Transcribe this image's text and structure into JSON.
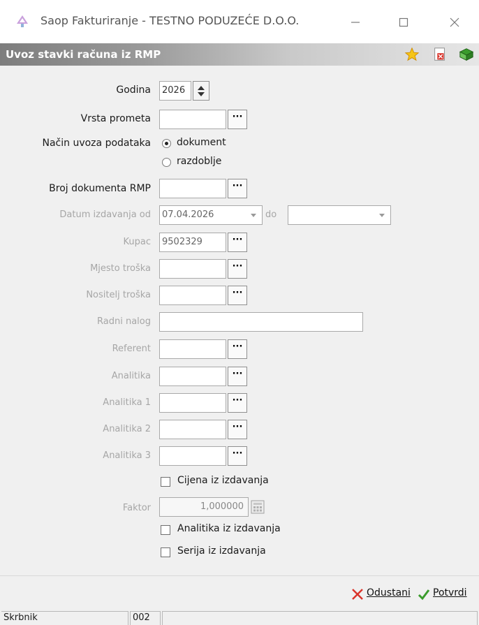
{
  "window": {
    "title": "Saop Fakturiranje - TESTNO PODUZEĆE D.O.O."
  },
  "header": {
    "title": "Uvoz stavki računa iz RMP"
  },
  "form": {
    "godina": {
      "label": "Godina",
      "value": "2026"
    },
    "vrsta_prometa": {
      "label": "Vrsta prometa",
      "value": ""
    },
    "nacin_uvoza": {
      "label": "Način uvoza podataka",
      "options": [
        "dokument",
        "razdoblje"
      ],
      "selected": "dokument"
    },
    "broj_dokumenta": {
      "label": "Broj dokumenta RMP",
      "value": ""
    },
    "datum_izdavanja": {
      "label": "Datum izdavanja od",
      "from": "07.04.2026",
      "to_label": "do",
      "to": ""
    },
    "kupac": {
      "label": "Kupac",
      "value": "9502329"
    },
    "mjesto_troska": {
      "label": "Mjesto troška",
      "value": ""
    },
    "nositelj_troska": {
      "label": "Nositelj troška",
      "value": ""
    },
    "radni_nalog": {
      "label": "Radni nalog",
      "value": ""
    },
    "referent": {
      "label": "Referent",
      "value": ""
    },
    "analitika": {
      "label": "Analitika",
      "value": ""
    },
    "analitika1": {
      "label": "Analitika 1",
      "value": ""
    },
    "analitika2": {
      "label": "Analitika 2",
      "value": ""
    },
    "analitika3": {
      "label": "Analitika 3",
      "value": ""
    },
    "cijena_iz_izdavanja": {
      "label": "Cijena iz izdavanja",
      "checked": false
    },
    "faktor": {
      "label": "Faktor",
      "value": "1,000000"
    },
    "analitika_iz_izdavanja": {
      "label": "Analitika iz izdavanja",
      "checked": false
    },
    "serija_iz_izdavanja": {
      "label": "Serija iz izdavanja",
      "checked": false
    }
  },
  "actions": {
    "cancel_label": "Odustani",
    "confirm_label": "Potvrdi"
  },
  "status": {
    "user": "Skrbnik",
    "code": "002",
    "extra": ""
  },
  "colors": {
    "accent_red": "#d9342b",
    "accent_green": "#3a9b2c",
    "disabled_text": "#a6a6a6"
  }
}
